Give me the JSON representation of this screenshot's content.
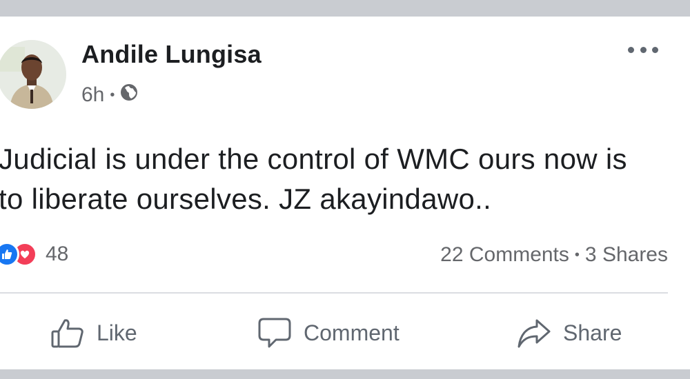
{
  "post": {
    "author": "Andile Lungisa",
    "time": "6h",
    "separator": "•",
    "privacy_icon": "globe-icon",
    "text_line1": "Judicial is under the control of WMC ours now is",
    "text_line2": "to liberate ourselves. JZ akayindawo..",
    "reaction_count": "48",
    "comments": "22 Comments",
    "shares": "3 Shares"
  },
  "actions": {
    "like": "Like",
    "comment": "Comment",
    "share": "Share"
  },
  "colors": {
    "like_blue": "#1877f2",
    "love_red": "#f33e58",
    "secondary_text": "#65676b"
  }
}
